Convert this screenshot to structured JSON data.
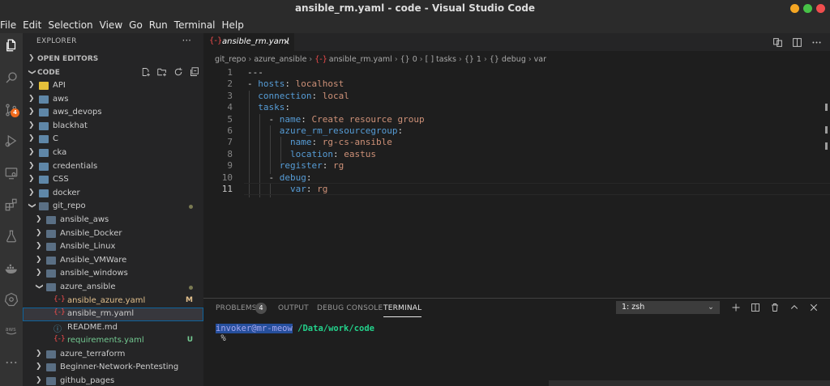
{
  "window": {
    "title": "ansible_rm.yaml - code - Visual Studio Code"
  },
  "menu": [
    "File",
    "Edit",
    "Selection",
    "View",
    "Go",
    "Run",
    "Terminal",
    "Help"
  ],
  "activity_bar": {
    "scm_badge": "4"
  },
  "sidebar": {
    "title": "EXPLORER",
    "more": "···",
    "open_editors": "OPEN EDITORS",
    "workspace": "CODE",
    "tree": [
      {
        "name": "API",
        "kind": "folder",
        "color": "yellow",
        "depth": 0,
        "expanded": false
      },
      {
        "name": "aws",
        "kind": "folder",
        "color": "blue",
        "depth": 0,
        "expanded": false
      },
      {
        "name": "aws_devops",
        "kind": "folder",
        "color": "blue",
        "depth": 0,
        "expanded": false
      },
      {
        "name": "blackhat",
        "kind": "folder",
        "color": "blue",
        "depth": 0,
        "expanded": false
      },
      {
        "name": "C",
        "kind": "folder",
        "color": "blue",
        "depth": 0,
        "expanded": false
      },
      {
        "name": "cka",
        "kind": "folder",
        "color": "blue",
        "depth": 0,
        "expanded": false
      },
      {
        "name": "credentials",
        "kind": "folder",
        "color": "blue",
        "depth": 0,
        "expanded": false
      },
      {
        "name": "CSS",
        "kind": "folder",
        "color": "blue",
        "depth": 0,
        "expanded": false
      },
      {
        "name": "docker",
        "kind": "folder",
        "color": "blue",
        "depth": 0,
        "expanded": false
      },
      {
        "name": "git_repo",
        "kind": "folder",
        "color": "dark",
        "depth": 0,
        "expanded": true,
        "dot": true
      },
      {
        "name": "ansible_aws",
        "kind": "folder",
        "color": "dark",
        "depth": 1,
        "expanded": false
      },
      {
        "name": "Ansible_Docker",
        "kind": "folder",
        "color": "dark",
        "depth": 1,
        "expanded": false
      },
      {
        "name": "Ansible_Linux",
        "kind": "folder",
        "color": "dark",
        "depth": 1,
        "expanded": false
      },
      {
        "name": "Ansible_VMWare",
        "kind": "folder",
        "color": "dark",
        "depth": 1,
        "expanded": false
      },
      {
        "name": "ansible_windows",
        "kind": "folder",
        "color": "dark",
        "depth": 1,
        "expanded": false
      },
      {
        "name": "azure_ansible",
        "kind": "folder",
        "color": "dark",
        "depth": 1,
        "expanded": true,
        "dot": true
      },
      {
        "name": "ansible_azure.yaml",
        "kind": "yaml",
        "depth": 2,
        "git": "M",
        "git_color": "#e2c08d",
        "name_color": "#e2c08d"
      },
      {
        "name": "ansible_rm.yaml",
        "kind": "yaml",
        "depth": 2,
        "selected": true,
        "name_color": "#cccccc"
      },
      {
        "name": "README.md",
        "kind": "info",
        "depth": 2,
        "name_color": "#cccccc"
      },
      {
        "name": "requirements.yaml",
        "kind": "yaml",
        "depth": 2,
        "git": "U",
        "git_color": "#73c991",
        "name_color": "#73c991"
      },
      {
        "name": "azure_terraform",
        "kind": "folder",
        "color": "dark",
        "depth": 1,
        "expanded": false
      },
      {
        "name": "Beginner-Network-Pentesting",
        "kind": "folder",
        "color": "dark",
        "depth": 1,
        "expanded": false
      },
      {
        "name": "github_pages",
        "kind": "folder",
        "color": "dark",
        "depth": 1,
        "expanded": false
      }
    ]
  },
  "editor": {
    "tab_icon": "{-}",
    "tab_label": "ansible_rm.yaml",
    "tab_close": "×",
    "breadcrumb": [
      "git_repo",
      "azure_ansible",
      "ansible_rm.yaml",
      "{} 0",
      "[ ] tasks",
      "{} 1",
      "{} debug",
      "var"
    ],
    "lines": [
      [
        [
          "p",
          "---"
        ]
      ],
      [
        [
          "dash",
          "- "
        ],
        [
          "k",
          "hosts"
        ],
        [
          "p",
          ": "
        ],
        [
          "s",
          "localhost"
        ]
      ],
      [
        [
          "p",
          "  "
        ],
        [
          "k",
          "connection"
        ],
        [
          "p",
          ": "
        ],
        [
          "s",
          "local"
        ]
      ],
      [
        [
          "p",
          "  "
        ],
        [
          "k",
          "tasks"
        ],
        [
          "p",
          ":"
        ]
      ],
      [
        [
          "p",
          "    "
        ],
        [
          "dash",
          "- "
        ],
        [
          "k",
          "name"
        ],
        [
          "p",
          ": "
        ],
        [
          "s",
          "Create resource group"
        ]
      ],
      [
        [
          "p",
          "      "
        ],
        [
          "k",
          "azure_rm_resourcegroup"
        ],
        [
          "p",
          ":"
        ]
      ],
      [
        [
          "p",
          "        "
        ],
        [
          "k",
          "name"
        ],
        [
          "p",
          ": "
        ],
        [
          "s",
          "rg-cs-ansible"
        ]
      ],
      [
        [
          "p",
          "        "
        ],
        [
          "k",
          "location"
        ],
        [
          "p",
          ": "
        ],
        [
          "s",
          "eastus"
        ]
      ],
      [
        [
          "p",
          "      "
        ],
        [
          "k",
          "register"
        ],
        [
          "p",
          ": "
        ],
        [
          "s",
          "rg"
        ]
      ],
      [
        [
          "p",
          "    "
        ],
        [
          "dash",
          "- "
        ],
        [
          "k",
          "debug"
        ],
        [
          "p",
          ":"
        ]
      ],
      [
        [
          "p",
          "        "
        ],
        [
          "k",
          "var"
        ],
        [
          "p",
          ": "
        ],
        [
          "s",
          "rg"
        ]
      ]
    ],
    "current_line": 11
  },
  "panel": {
    "tabs": [
      "PROBLEMS",
      "OUTPUT",
      "DEBUG CONSOLE",
      "TERMINAL"
    ],
    "problems_count": "4",
    "active_tab": "TERMINAL",
    "terminal_select": "1: zsh",
    "terminal": {
      "user": "invoker@mr-meow",
      "path": "/Data/work/code",
      "prompt": " %"
    }
  }
}
